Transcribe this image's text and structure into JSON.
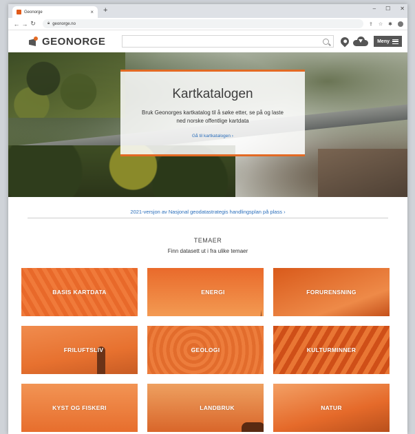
{
  "browser": {
    "tab_title": "Geonorge",
    "tab_close": "×",
    "new_tab": "+",
    "address": "geonorge.no",
    "win_controls": [
      "–",
      "☐",
      "✕"
    ]
  },
  "header": {
    "logo_text": "GEONORGE",
    "search_placeholder": "",
    "menu_label": "Meny"
  },
  "hero": {
    "title": "Kartkatalogen",
    "text": "Bruk Geonorges kartkatalog til å søke etter, se på og laste ned norske offentlige kartdata",
    "link": "Gå til kartkatalogen  ›"
  },
  "notice": {
    "link": "2021-versjon av Nasjonal geodatastrategis handlingsplan på plass  ›"
  },
  "themes": {
    "title": "TEMAER",
    "subtitle": "Finn datasett ut i fra ulike temaer",
    "tiles": [
      "BASIS KARTDATA",
      "ENERGI",
      "FORURENSNING",
      "FRILUFTSLIV",
      "GEOLOGI",
      "KULTURMINNER",
      "KYST OG FISKERI",
      "LANDBRUK",
      "NATUR"
    ]
  },
  "colors": {
    "accent": "#e36a24",
    "link": "#2a6ebb"
  }
}
